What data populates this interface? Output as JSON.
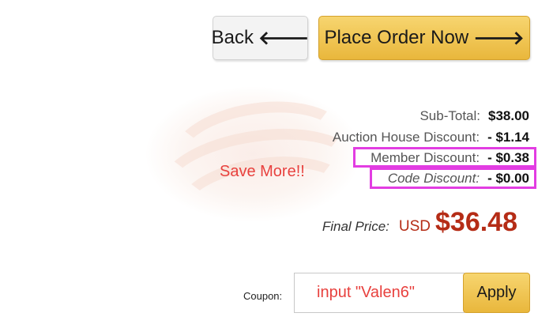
{
  "buttons": {
    "back": "Back",
    "back_arrow": "🡐",
    "place_order": "Place Order Now",
    "place_order_arrow": "🡒",
    "apply": "Apply"
  },
  "summary": {
    "subtotal_label": "Sub-Total:",
    "subtotal_value": "$38.00",
    "auction_label": "Auction House Discount:",
    "auction_value": "- $1.14",
    "member_label": "Member Discount:",
    "member_value": "- $0.38",
    "code_label": "Code Discount:",
    "code_value": "- $0.00"
  },
  "annotation": {
    "save_more": "Save More!!",
    "coupon_hint": "input \"Valen6\""
  },
  "final": {
    "label": "Final Price:",
    "currency": "USD",
    "amount": "$36.48"
  },
  "coupon": {
    "label": "Coupon:"
  },
  "colors": {
    "accent_gold": "#e9b73c",
    "price_red": "#b52c16",
    "highlight": "#e23de2",
    "annotation_red": "#e8413e"
  }
}
